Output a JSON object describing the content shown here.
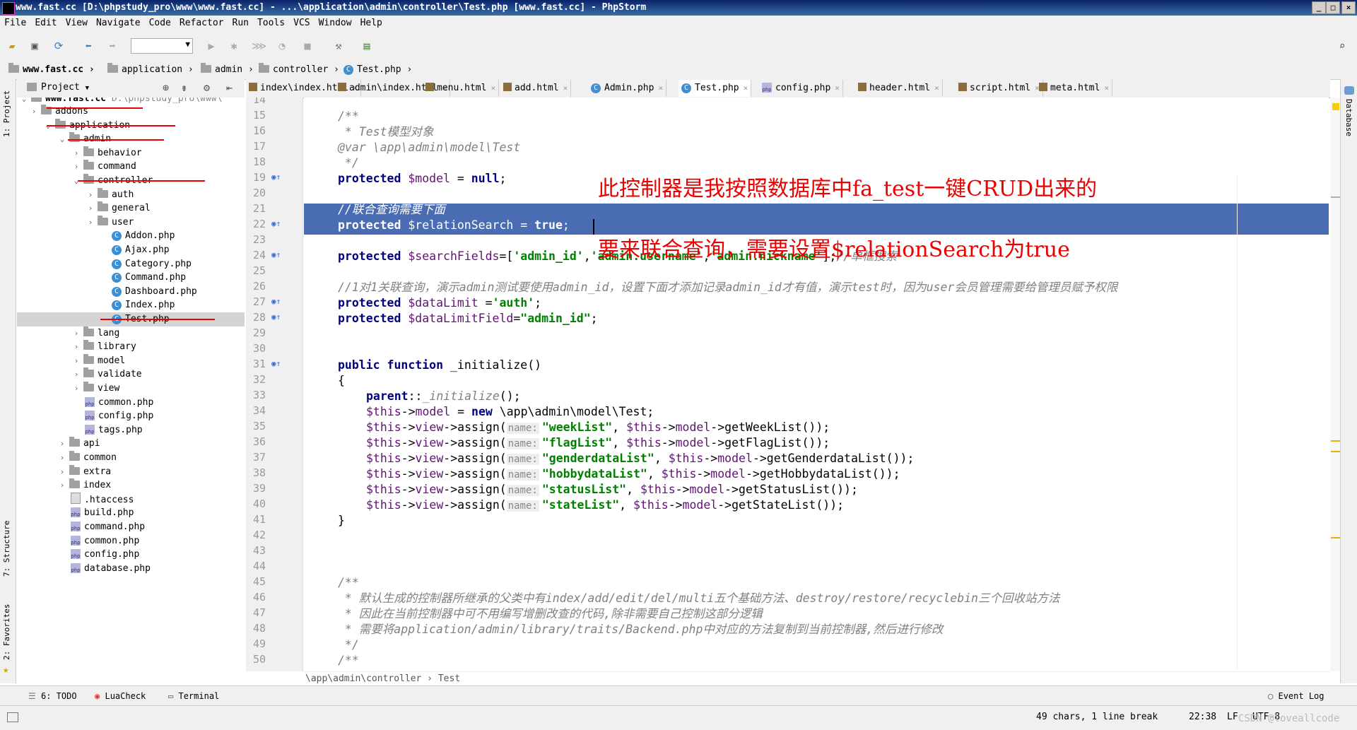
{
  "window": {
    "title": "www.fast.cc [D:\\phpstudy_pro\\www\\www.fast.cc] - ...\\application\\admin\\controller\\Test.php [www.fast.cc] - PhpStorm",
    "minimize": "_",
    "maximize": "□",
    "close": "×"
  },
  "menu": [
    "File",
    "Edit",
    "View",
    "Navigate",
    "Code",
    "Refactor",
    "Run",
    "Tools",
    "VCS",
    "Window",
    "Help"
  ],
  "navbar": {
    "crumbs": [
      "www.fast.cc",
      "application",
      "admin",
      "controller",
      "Test.php"
    ]
  },
  "left_strip": {
    "project": "1: Project",
    "structure": "7: Structure",
    "favorites": "2: Favorites"
  },
  "right_strip": {
    "database": "Database"
  },
  "project_panel": {
    "title": "Project",
    "root_name": "www.fast.cc",
    "root_path": "D:\\phpstudy_pro\\www\\",
    "tree": [
      {
        "label": "addons",
        "type": "folder",
        "arrow": "›"
      },
      {
        "label": "application",
        "type": "folder",
        "arrow": "⌄"
      },
      {
        "label": "admin",
        "type": "folder",
        "arrow": "⌄"
      },
      {
        "label": "behavior",
        "type": "folder",
        "arrow": "›"
      },
      {
        "label": "command",
        "type": "folder",
        "arrow": "›"
      },
      {
        "label": "controller",
        "type": "folder",
        "arrow": "⌄"
      },
      {
        "label": "auth",
        "type": "folder",
        "arrow": "›"
      },
      {
        "label": "general",
        "type": "folder",
        "arrow": "›"
      },
      {
        "label": "user",
        "type": "folder",
        "arrow": "›"
      },
      {
        "label": "Addon.php",
        "type": "class"
      },
      {
        "label": "Ajax.php",
        "type": "class"
      },
      {
        "label": "Category.php",
        "type": "class"
      },
      {
        "label": "Command.php",
        "type": "class"
      },
      {
        "label": "Dashboard.php",
        "type": "class"
      },
      {
        "label": "Index.php",
        "type": "class"
      },
      {
        "label": "Test.php",
        "type": "class"
      },
      {
        "label": "lang",
        "type": "folder",
        "arrow": "›"
      },
      {
        "label": "library",
        "type": "folder",
        "arrow": "›"
      },
      {
        "label": "model",
        "type": "folder",
        "arrow": "›"
      },
      {
        "label": "validate",
        "type": "folder",
        "arrow": "›"
      },
      {
        "label": "view",
        "type": "folder",
        "arrow": "›"
      },
      {
        "label": "common.php",
        "type": "php"
      },
      {
        "label": "config.php",
        "type": "php"
      },
      {
        "label": "tags.php",
        "type": "php"
      },
      {
        "label": "api",
        "type": "folder",
        "arrow": "›"
      },
      {
        "label": "common",
        "type": "folder",
        "arrow": "›"
      },
      {
        "label": "extra",
        "type": "folder",
        "arrow": "›"
      },
      {
        "label": "index",
        "type": "folder",
        "arrow": "›"
      },
      {
        "label": ".htaccess",
        "type": "file"
      },
      {
        "label": "build.php",
        "type": "php"
      },
      {
        "label": "command.php",
        "type": "php"
      },
      {
        "label": "common.php",
        "type": "php"
      },
      {
        "label": "config.php",
        "type": "php"
      },
      {
        "label": "database.php",
        "type": "php"
      }
    ]
  },
  "tabs": [
    {
      "label": "index\\index.html",
      "icon": "html"
    },
    {
      "label": "admin\\index.html",
      "icon": "html"
    },
    {
      "label": "menu.html",
      "icon": "html"
    },
    {
      "label": "add.html",
      "icon": "html"
    },
    {
      "label": "Admin.php",
      "icon": "class"
    },
    {
      "label": "Test.php",
      "icon": "class"
    },
    {
      "label": "config.php",
      "icon": "php"
    },
    {
      "label": "header.html",
      "icon": "html"
    },
    {
      "label": "script.html",
      "icon": "html"
    },
    {
      "label": "meta.html",
      "icon": "html"
    }
  ],
  "editor": {
    "line_numbers": [
      "14",
      "15",
      "16",
      "17",
      "18",
      "19",
      "20",
      "21",
      "22",
      "23",
      "24",
      "25",
      "26",
      "27",
      "28",
      "29",
      "30",
      "31",
      "32",
      "33",
      "34",
      "35",
      "36",
      "37",
      "38",
      "39",
      "40",
      "41",
      "42",
      "43",
      "44",
      "45",
      "46",
      "47",
      "48",
      "49",
      "50"
    ],
    "lines": {
      "l15": "/**",
      "l16": " * Test模型对象",
      "l17_tag": "@var",
      "l17_rest": " \\app\\admin\\model\\Test",
      "l18": " */",
      "l19_kw": "protected",
      "l19_var": " $model",
      "l19_rest": " = ",
      "l19_null": "null",
      "l19_end": ";",
      "l21": "//联合查询需要下面",
      "l22_kw": "protected",
      "l22_var": " $relationSearch",
      "l22_rest": " = ",
      "l22_true": "true",
      "l22_end": ";",
      "l24_kw": "protected",
      "l24_var": " $searchFields",
      "l24_rest": "=[",
      "l24_s1": "'admin_id'",
      "l24_c1": ",",
      "l24_s2": "'admin.username'",
      "l24_c2": ",",
      "l24_s3": "'admin.nickname'",
      "l24_end": "];",
      "l24_cmt": "//单框搜索",
      "l26": "//1对1关联查询，演示admin测试要使用admin_id，设置下面才添加记录admin_id才有值，演示test时，因为user会员管理需要给管理员赋予权限",
      "l27_kw": "protected",
      "l27_var": " $dataLimit",
      "l27_rest": " =",
      "l27_str": "'auth'",
      "l27_end": ";",
      "l28_kw": "protected",
      "l28_var": " $dataLimitField",
      "l28_rest": "=",
      "l28_str": "\"admin_id\"",
      "l28_end": ";",
      "l31_kw": "public function",
      "l31_rest": " _initialize()",
      "l32": "{",
      "l33_kw": "parent",
      "l33_rest": "::",
      "l33_fn": "_initialize",
      "l33_end": "();",
      "l34_var": "$this",
      "l34_arrow": "->",
      "l34_prop": "model",
      "l34_rest": " = ",
      "l34_new": "new",
      "l34_end": " \\app\\admin\\model\\Test;",
      "hint_name": "name:",
      "assigns": [
        {
          "key": "\"weekList\"",
          "fn": "getWeekList"
        },
        {
          "key": "\"flagList\"",
          "fn": "getFlagList"
        },
        {
          "key": "\"genderdataList\"",
          "fn": "getGenderdataList"
        },
        {
          "key": "\"hobbydataList\"",
          "fn": "getHobbydataList"
        },
        {
          "key": "\"statusList\"",
          "fn": "getStatusList"
        },
        {
          "key": "\"stateList\"",
          "fn": "getStateList"
        }
      ],
      "assign_this": "$this",
      "assign_arrow": "->",
      "assign_view": "view",
      "assign_call": "->assign(",
      "assign_model": "model",
      "assign_end": "());",
      "l41": "}",
      "l45": "/**",
      "l46": " * 默认生成的控制器所继承的父类中有index/add/edit/del/multi五个基础方法、destroy/restore/recyclebin三个回收站方法",
      "l47": " * 因此在当前控制器中可不用编写增删改查的代码,除非需要自己控制这部分逻辑",
      "l48": " * 需要将application/admin/library/traits/Backend.php中对应的方法复制到当前控制器,然后进行修改",
      "l49": " */",
      "l50": "/**"
    },
    "annotation1": "此控制器是我按照数据库中fa_test一键CRUD出来的",
    "annotation2": "要来联合查询，需要设置$relationSearch为true",
    "breadcrumb": "\\app\\admin\\controller  ›  Test"
  },
  "bottom_tools": [
    "6: TODO",
    "LuaCheck",
    "Terminal"
  ],
  "event_log": "Event Log",
  "status": {
    "selection": "49 chars, 1 line break",
    "position": "22:38",
    "line_sep": "LF",
    "encoding": "UTF-8",
    "watermark": "CSDN @loveallcode"
  },
  "colors": {
    "selection": "#4a6cb3",
    "annotation": "#e00000",
    "keyword": "#000080",
    "string": "#008000"
  }
}
